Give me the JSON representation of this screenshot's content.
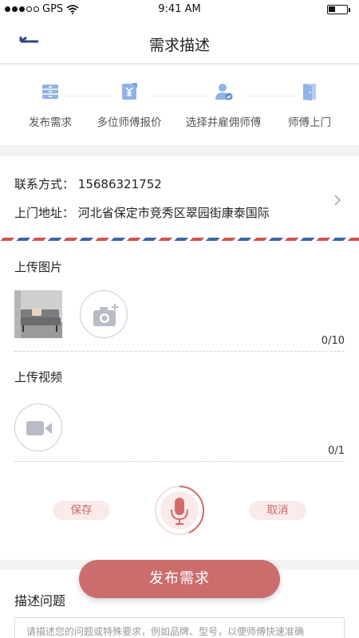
{
  "status_bar": {
    "carrier": "GPS",
    "time": "9:41 AM",
    "battery_level": 0.4
  },
  "nav": {
    "title": "需求描述",
    "back_icon": "back-arrow-icon"
  },
  "steps": [
    {
      "label": "发布需求",
      "icon": "drawer-icon"
    },
    {
      "label": "多位师傅报价",
      "icon": "price-tag-icon"
    },
    {
      "label": "选择并雇佣师傅",
      "icon": "worker-check-icon"
    },
    {
      "label": "师傅上门",
      "icon": "door-icon"
    }
  ],
  "contact": {
    "phone_label": "联系方式：",
    "phone": "15686321752",
    "address_label": "上门地址：",
    "address": "河北省保定市竞秀区翠园街康泰国际"
  },
  "images": {
    "title": "上传图片",
    "count": "0/10"
  },
  "video": {
    "title": "上传视频",
    "count": "0/1"
  },
  "recorder": {
    "save": "保存",
    "cancel": "取消"
  },
  "description": {
    "title": "描述问题",
    "placeholder": "请描述您的问题或特殊要求，例如品牌、型号，以便师傅快速准确"
  },
  "publish": {
    "label": "发布需求"
  },
  "colors": {
    "accent": "#cc6d6d",
    "pill_bg": "#fbeaea",
    "step_icon": "#8fb3e6"
  }
}
